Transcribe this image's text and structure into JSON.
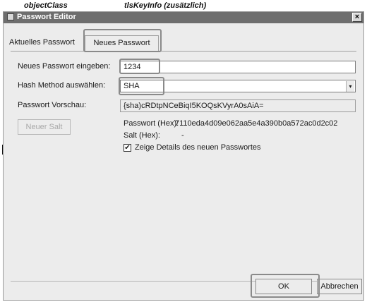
{
  "background_header": {
    "col1": "objectClass",
    "col2": "tlsKeyInfo (zusätzlich)"
  },
  "dialog": {
    "title": "Passwort Editor",
    "close_glyph": "×"
  },
  "tabs": [
    {
      "label": "Aktuelles Passwort",
      "active": false
    },
    {
      "label": "Neues Passwort",
      "active": true
    }
  ],
  "form": {
    "new_password_label": "Neues Passwort eingeben:",
    "new_password_value": "1234",
    "hash_method_label": "Hash Method auswählen:",
    "hash_method_value": "SHA",
    "preview_label": "Passwort Vorschau:",
    "preview_value": "{sha)cRDtpNCeBiqI5KOQsKVyrA0sAiA=",
    "new_salt_button": "Neuer Salt",
    "password_hex_label": "Passwort (Hex):",
    "password_hex_value": "7110eda4d09e062aa5e4a390b0a572ac0d2c02",
    "salt_hex_label": "Salt (Hex):",
    "salt_hex_value": "-",
    "show_details_checked": true,
    "show_details_label": "Zeige Details des neuen Passwortes"
  },
  "footer": {
    "ok_button": "OK",
    "cancel_button": "Abbrechen"
  },
  "icons": {
    "select_arrow": "▾",
    "check_mark": "✔"
  },
  "colors": {
    "titlebar": "#6e6e6e",
    "dialog_bg": "#ececec",
    "highlight_box": "#8a8a8a"
  }
}
